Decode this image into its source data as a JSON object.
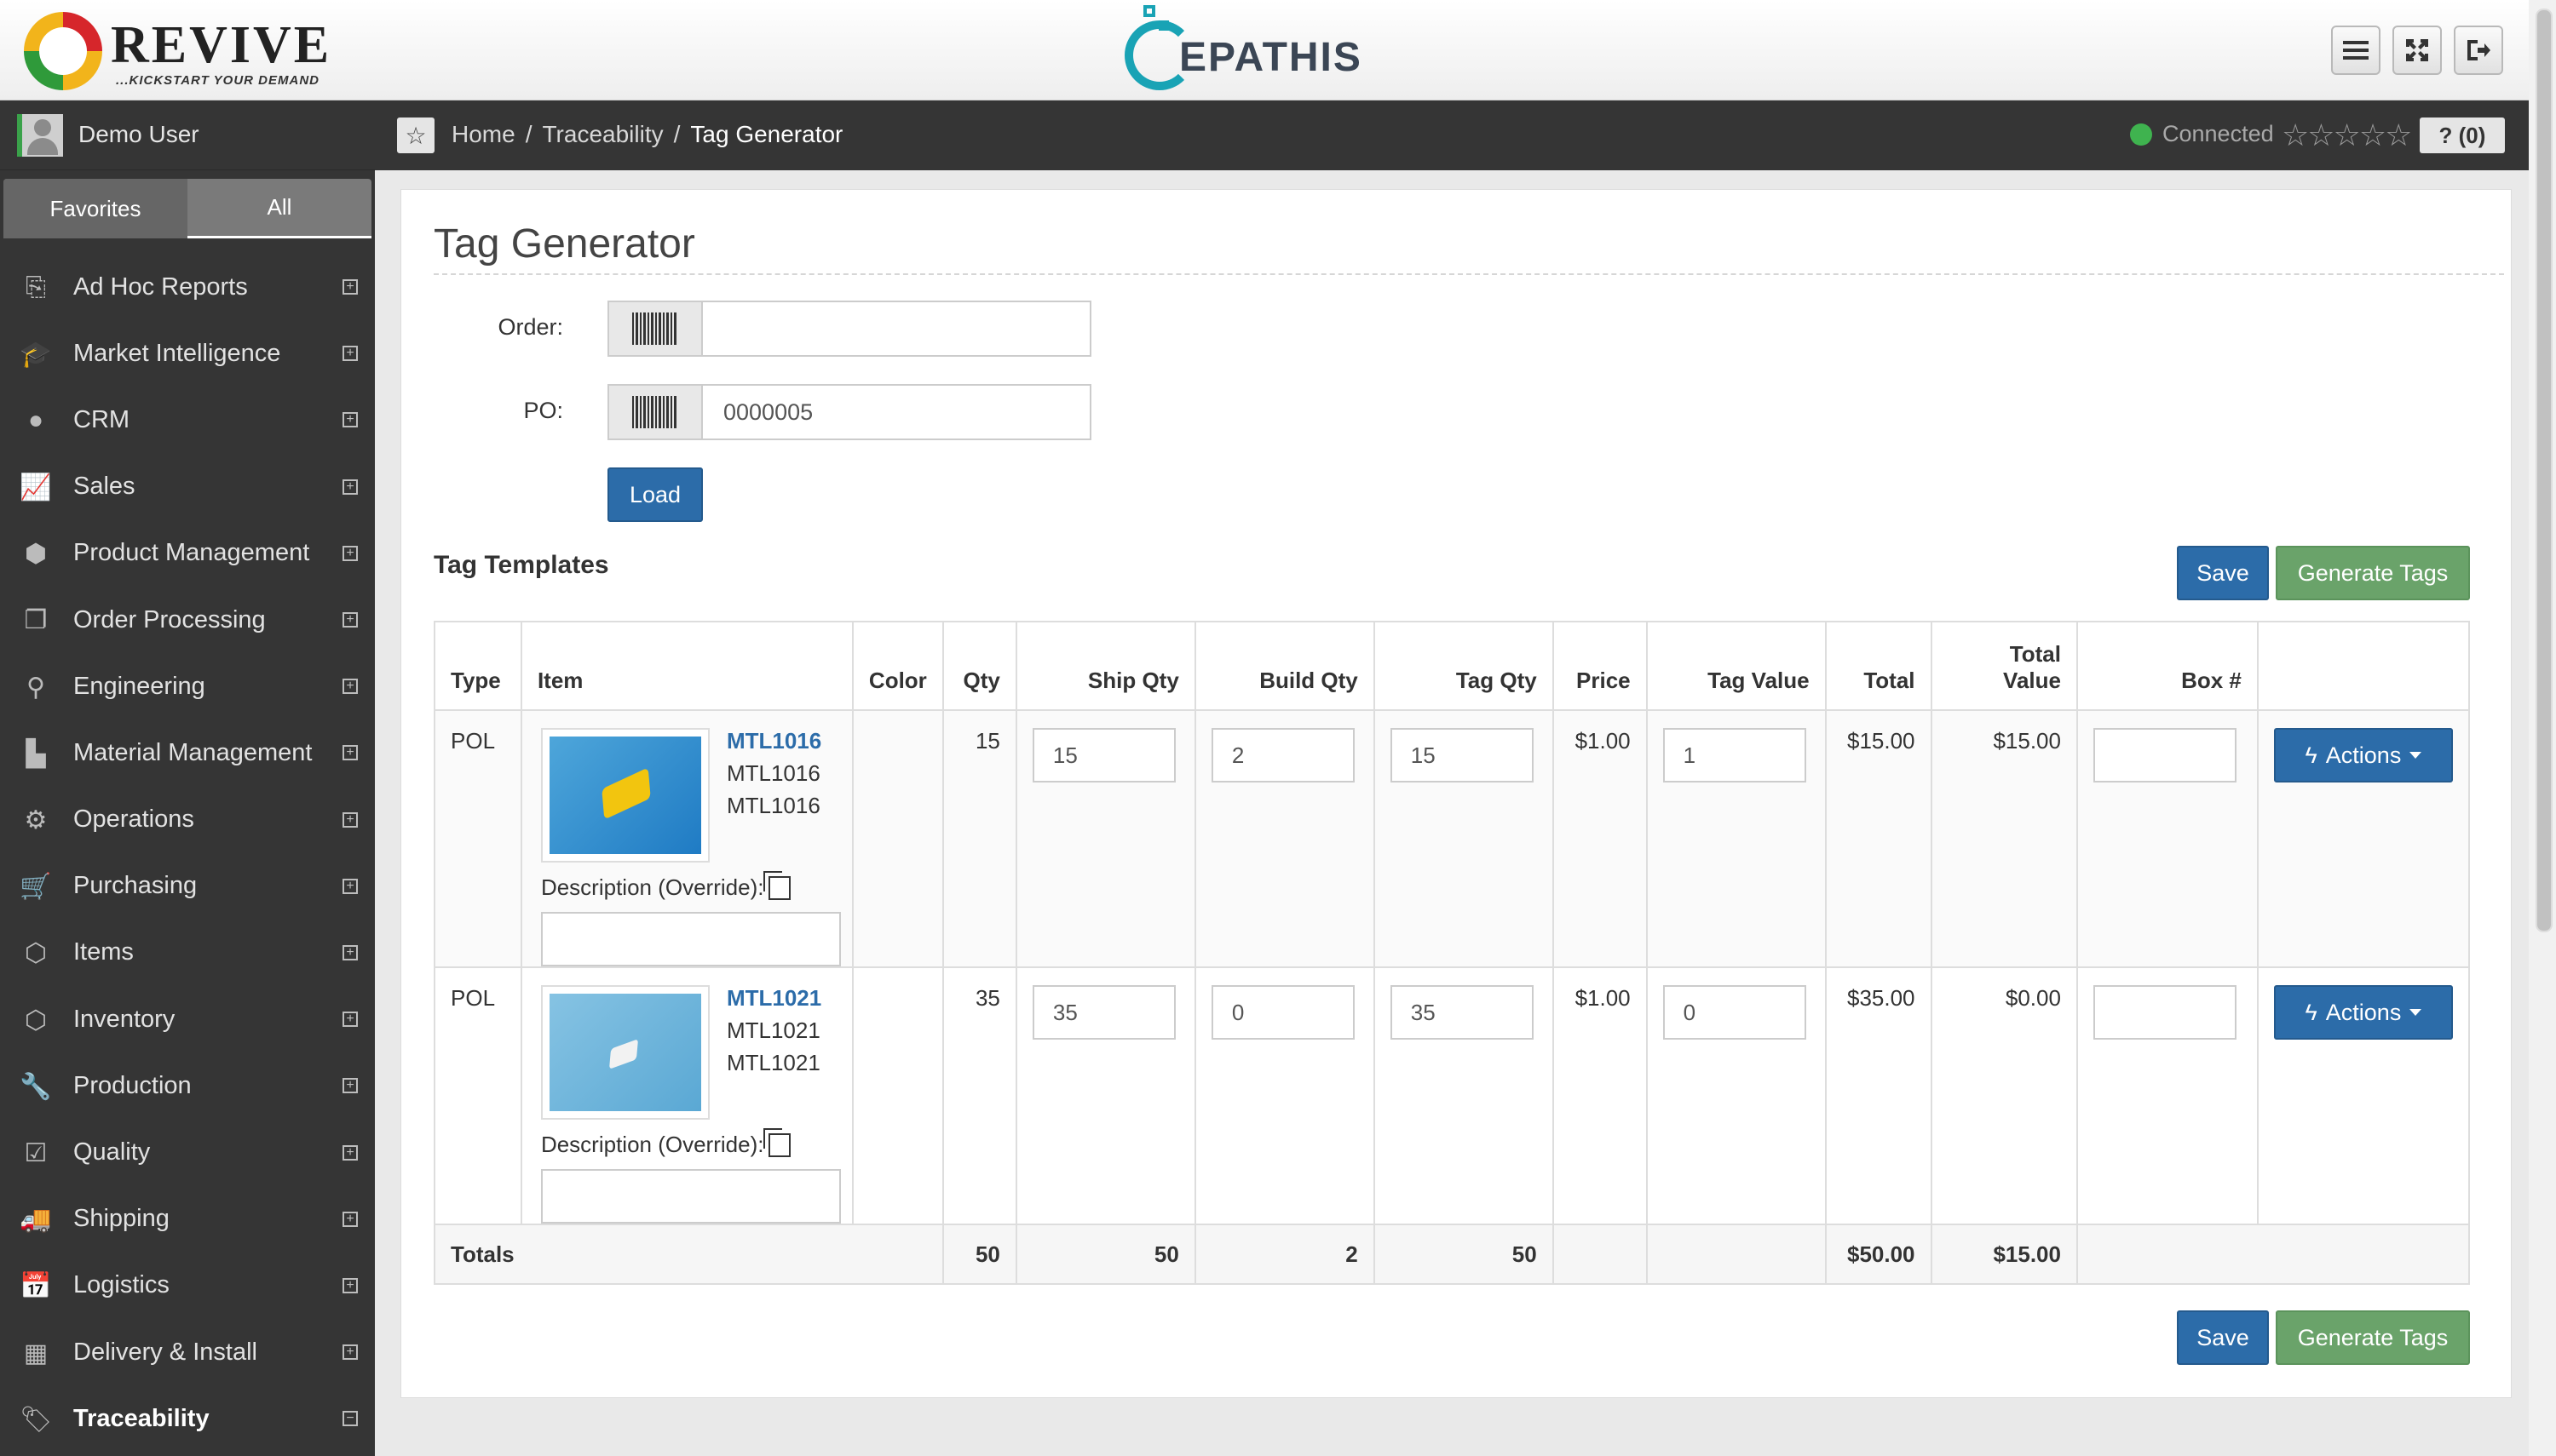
{
  "header": {
    "brand": "REVIVE",
    "brand_tagline": "...KICKSTART YOUR DEMAND",
    "center_brand": "EPATHIS",
    "buttons": [
      "menu-icon",
      "fullscreen-icon",
      "logout-icon"
    ]
  },
  "user": {
    "name": "Demo User"
  },
  "sidebar": {
    "tabs": [
      {
        "label": "Favorites"
      },
      {
        "label": "All"
      }
    ],
    "active_tab": "All",
    "items": [
      {
        "label": "Ad Hoc Reports",
        "icon": "reports-icon",
        "expander": "⊞"
      },
      {
        "label": "Market Intelligence",
        "icon": "graduation-cap-icon",
        "expander": "⊞"
      },
      {
        "label": "CRM",
        "icon": "user-icon",
        "expander": "⊞"
      },
      {
        "label": "Sales",
        "icon": "line-chart-icon",
        "expander": "⊞"
      },
      {
        "label": "Product Management",
        "icon": "cube-icon",
        "expander": "⊞"
      },
      {
        "label": "Order Processing",
        "icon": "files-icon",
        "expander": "⊞"
      },
      {
        "label": "Engineering",
        "icon": "engineering-icon",
        "expander": "⊞"
      },
      {
        "label": "Material Management",
        "icon": "factory-icon",
        "expander": "⊞"
      },
      {
        "label": "Operations",
        "icon": "gears-icon",
        "expander": "⊞"
      },
      {
        "label": "Purchasing",
        "icon": "cart-icon",
        "expander": "⊞"
      },
      {
        "label": "Items",
        "icon": "cubes-icon",
        "expander": "⊞"
      },
      {
        "label": "Inventory",
        "icon": "cubes-icon",
        "expander": "⊞"
      },
      {
        "label": "Production",
        "icon": "wrench-icon",
        "expander": "⊞"
      },
      {
        "label": "Quality",
        "icon": "check-square-icon",
        "expander": "⊞"
      },
      {
        "label": "Shipping",
        "icon": "truck-icon",
        "expander": "⊞"
      },
      {
        "label": "Logistics",
        "icon": "calendar-check-icon",
        "expander": "⊞"
      },
      {
        "label": "Delivery & Install",
        "icon": "building-icon",
        "expander": "⊞"
      },
      {
        "label": "Traceability",
        "icon": "tags-icon",
        "expander": "⊟"
      }
    ]
  },
  "breadcrumb": {
    "items": [
      "Home",
      "Traceability",
      "Tag Generator"
    ],
    "separator": "/"
  },
  "status": {
    "connection": "Connected",
    "connection_color": "#3fb34f",
    "rating_stars": "☆☆☆☆☆",
    "help_label": "? (0)"
  },
  "page": {
    "title": "Tag Generator",
    "order_label": "Order:",
    "order_value": "",
    "po_label": "PO:",
    "po_value": "0000005",
    "load_label": "Load",
    "section_title": "Tag Templates",
    "save_label": "Save",
    "generate_label": "Generate Tags"
  },
  "table": {
    "headers": {
      "type": "Type",
      "item": "Item",
      "color": "Color",
      "qty": "Qty",
      "ship_qty": "Ship Qty",
      "build_qty": "Build Qty",
      "tag_qty": "Tag Qty",
      "price": "Price",
      "tag_value": "Tag Value",
      "total": "Total",
      "total_value_1": "Total",
      "total_value_2": "Value",
      "box": "Box #"
    },
    "desc_label": "Description (Override):",
    "actions_label": "Actions",
    "rows": [
      {
        "type": "POL",
        "item_code": "MTL1016",
        "item_line2": "MTL1016",
        "item_line3": "MTL1016",
        "color": "",
        "qty": "15",
        "ship_qty": "15",
        "build_qty": "2",
        "tag_qty": "15",
        "price": "$1.00",
        "tag_value": "1",
        "total": "$15.00",
        "total_value": "$15.00",
        "box": ""
      },
      {
        "type": "POL",
        "item_code": "MTL1021",
        "item_line2": "MTL1021",
        "item_line3": "MTL1021",
        "color": "",
        "qty": "35",
        "ship_qty": "35",
        "build_qty": "0",
        "tag_qty": "35",
        "price": "$1.00",
        "tag_value": "0",
        "total": "$35.00",
        "total_value": "$0.00",
        "box": ""
      }
    ],
    "totals": {
      "label": "Totals",
      "qty": "50",
      "ship_qty": "50",
      "build_qty": "2",
      "tag_qty": "50",
      "total": "$50.00",
      "total_value": "$15.00"
    }
  }
}
